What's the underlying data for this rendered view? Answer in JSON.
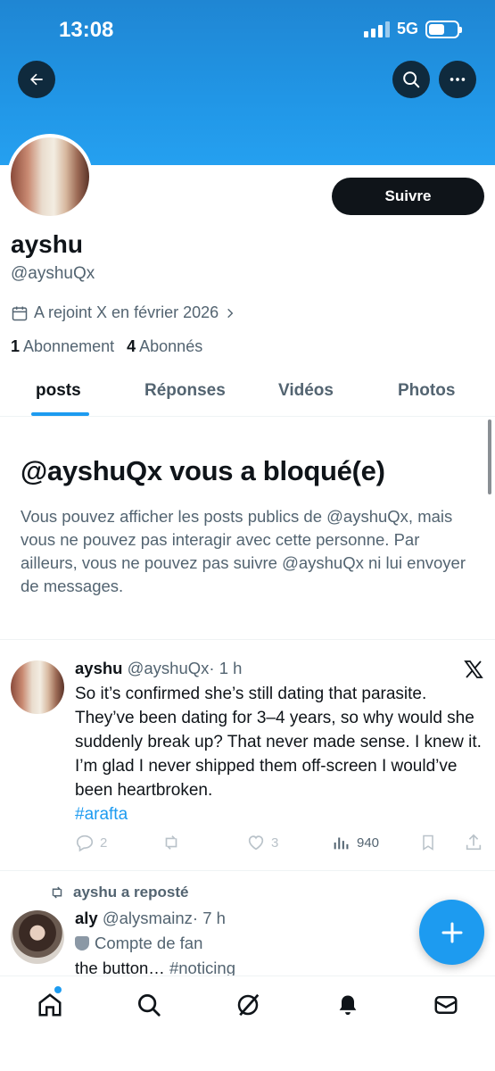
{
  "status_bar": {
    "time": "13:08",
    "network": "5G"
  },
  "profile": {
    "name": "ayshu",
    "handle": "@ayshuQx",
    "joined": "A rejoint X en février 2026",
    "following_count": "1",
    "following_label": "Abonnement",
    "followers_count": "4",
    "followers_label": "Abonnés",
    "follow_button": "Suivre"
  },
  "tabs": [
    "posts",
    "Réponses",
    "Vidéos",
    "Photos"
  ],
  "blocked": {
    "title": "@ayshuQx vous a bloqué(e)",
    "text": "Vous pouvez afficher les posts publics de @ayshuQx, mais vous ne pouvez pas interagir avec cette personne. Par ailleurs, vous ne pouvez pas suivre @ayshuQx ni lui envoyer de messages."
  },
  "tweet1": {
    "name": "ayshu",
    "handle": "@ayshuQx",
    "time": "· 1 h",
    "text": "So it’s confirmed she’s still dating that parasite. They’ve been dating for 3–4 years, so why would she suddenly break up? That never made sense. I knew it. I’m glad I never shipped them off-screen I would’ve been heartbroken.",
    "hashtag": "#arafta",
    "replies": "2",
    "likes": "3",
    "views": "940"
  },
  "repost_label": "ayshu a reposté",
  "tweet2": {
    "name": "aly",
    "handle": "@alysmainz",
    "time": "· 7 h",
    "badge": "Compte de fan",
    "text": "the button… ",
    "hashtag": "#noticing"
  },
  "icons": {
    "back": "back-arrow-icon",
    "search": "search-icon",
    "more": "more-icon",
    "calendar": "calendar-icon",
    "x_logo": "x-logo-icon",
    "compose": "plus-icon"
  },
  "colors": {
    "accent": "#1d9bf0",
    "banner": "#2196e6",
    "text": "#0f1419",
    "muted": "#536471"
  }
}
